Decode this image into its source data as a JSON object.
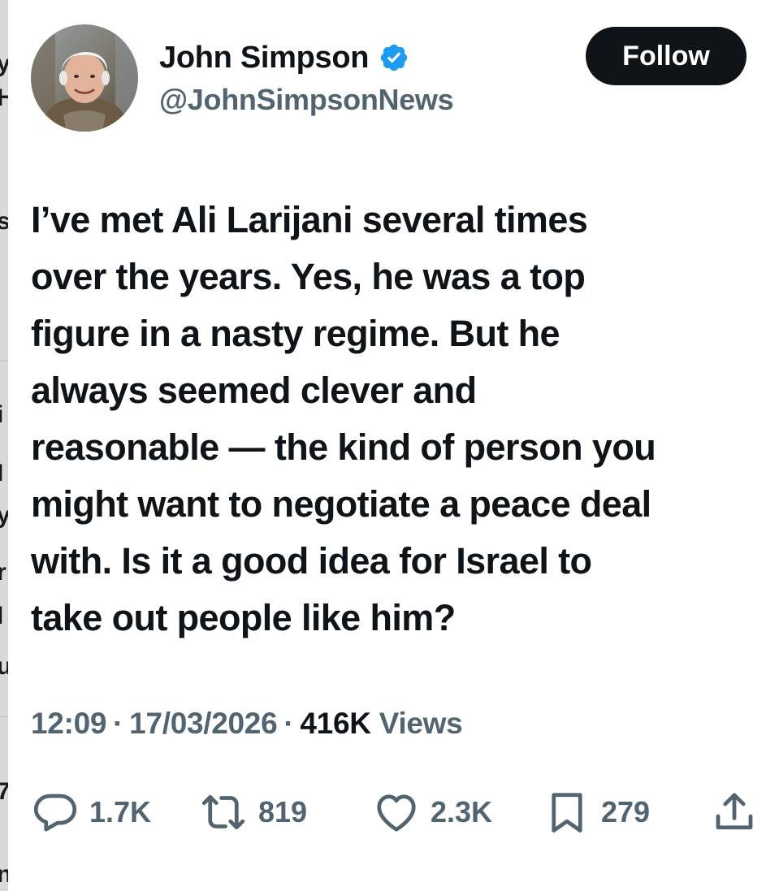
{
  "profile": {
    "display_name": "John Simpson",
    "handle": "@JohnSimpsonNews",
    "verified_icon": "verified-badge-icon",
    "verified_color": "#1d9bf0"
  },
  "follow_button": {
    "label": "Follow"
  },
  "tweet": {
    "text": "I’ve met Ali Larijani several times\nover the years. Yes, he was a top\nfigure in a nasty regime. But he\nalways seemed clever and\nreasonable — the kind of person you\nmight want to negotiate a peace deal\nwith. Is it a good idea for Israel to\ntake out people like him?"
  },
  "meta": {
    "time": "12:09",
    "separator": "·",
    "date": "17/03/2026",
    "views_count": "416K",
    "views_label": "Views"
  },
  "actions": {
    "reply": {
      "icon": "reply-icon",
      "count": "1.7K"
    },
    "retweet": {
      "icon": "retweet-icon",
      "count": "819"
    },
    "like": {
      "icon": "heart-icon",
      "count": "2.3K"
    },
    "bookmark": {
      "icon": "bookmark-icon",
      "count": "279"
    },
    "share": {
      "icon": "share-icon"
    }
  },
  "background_fragments": [
    "y",
    "H",
    "s",
    "i",
    "I",
    "y",
    "r",
    "l",
    "u",
    "7",
    "n"
  ],
  "colors": {
    "text": "#0f1419",
    "secondary": "#536471",
    "follow_bg": "#0f1419"
  }
}
